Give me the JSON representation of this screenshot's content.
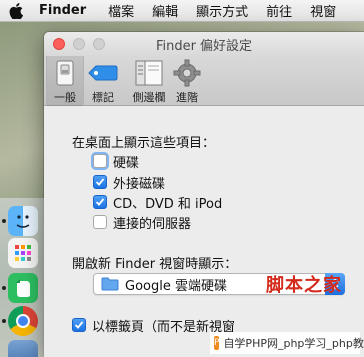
{
  "menubar": {
    "app_name": "Finder",
    "items": [
      "檔案",
      "編輯",
      "顯示方式",
      "前往",
      "視窗"
    ]
  },
  "window": {
    "title": "Finder 偏好設定",
    "tabs": [
      {
        "label": "一般",
        "icon": "general-switch-icon",
        "selected": true
      },
      {
        "label": "標記",
        "icon": "tag-icon",
        "selected": false
      },
      {
        "label": "側邊欄",
        "icon": "sidebar-icon",
        "selected": false
      },
      {
        "label": "進階",
        "icon": "gear-icon",
        "selected": false
      }
    ]
  },
  "general": {
    "desktop_section_label": "在桌面上顯示這些項目：",
    "desktop_items": [
      {
        "label": "硬碟",
        "checked": false
      },
      {
        "label": "外接磁碟",
        "checked": true
      },
      {
        "label": "CD、DVD 和 iPod",
        "checked": true
      },
      {
        "label": "連接的伺服器",
        "checked": false
      }
    ],
    "new_window_label": "開啟新 Finder 視窗時顯示：",
    "new_window_value": "Google 雲端硬碟",
    "tabs_checkbox": {
      "label": "以標籤頁（而不是新視窗",
      "checked": true
    }
  },
  "watermark": {
    "logo_text": "脚本之家",
    "site_text": "自学PHP网_php学习_php教"
  },
  "colors": {
    "accent": "#1c72e3",
    "close_button": "#fc605c"
  }
}
